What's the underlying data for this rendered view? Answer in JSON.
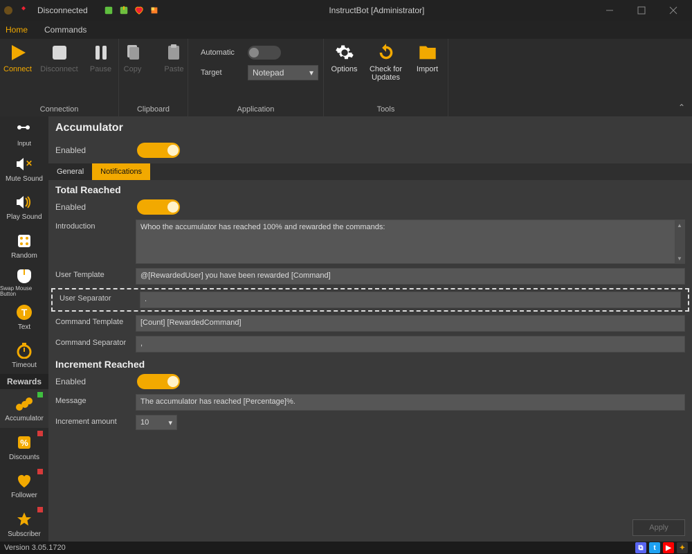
{
  "window": {
    "title": "InstructBot [Administrator]",
    "connection_status": "Disconnected"
  },
  "menu": {
    "home": "Home",
    "commands": "Commands"
  },
  "ribbon": {
    "connection": {
      "label": "Connection",
      "connect": "Connect",
      "disconnect": "Disconnect",
      "pause": "Pause"
    },
    "clipboard": {
      "label": "Clipboard",
      "copy": "Copy",
      "paste": "Paste"
    },
    "application": {
      "label": "Application",
      "automatic": "Automatic",
      "target": "Target",
      "target_value": "Notepad"
    },
    "tools": {
      "label": "Tools",
      "options": "Options",
      "check_updates": "Check for Updates",
      "import": "Import"
    }
  },
  "sidebar": {
    "items": [
      {
        "label": "Input"
      },
      {
        "label": "Mute Sound"
      },
      {
        "label": "Play Sound"
      },
      {
        "label": "Random"
      },
      {
        "label": "Swap Mouse Button"
      },
      {
        "label": "Text"
      },
      {
        "label": "Timeout"
      }
    ],
    "section": "Rewards",
    "rewards": [
      {
        "label": "Accumulator",
        "dot": "#3fbf3f",
        "active": true
      },
      {
        "label": "Discounts",
        "dot": "#d63a3a"
      },
      {
        "label": "Follower",
        "dot": "#d63a3a"
      },
      {
        "label": "Subscriber",
        "dot": "#d63a3a"
      }
    ]
  },
  "content": {
    "title": "Accumulator",
    "enabled_label": "Enabled",
    "tabs": {
      "general": "General",
      "notifications": "Notifications"
    },
    "total_reached": {
      "heading": "Total Reached",
      "enabled": "Enabled",
      "introduction_label": "Introduction",
      "introduction_value": "Whoo the accumulator has reached 100% and rewarded the commands:",
      "user_template_label": "User Template",
      "user_template_value": "@[RewardedUser] you have been rewarded [Command]",
      "user_separator_label": "User Separator",
      "user_separator_value": ".",
      "command_template_label": "Command Template",
      "command_template_value": "[Count] [RewardedCommand]",
      "command_separator_label": "Command Separator",
      "command_separator_value": ","
    },
    "increment_reached": {
      "heading": "Increment Reached",
      "enabled": "Enabled",
      "message_label": "Message",
      "message_value": "The accumulator has reached [Percentage]%.",
      "increment_amount_label": "Increment amount",
      "increment_amount_value": "10"
    },
    "apply": "Apply"
  },
  "status": {
    "version": "Version 3.05.1720"
  }
}
